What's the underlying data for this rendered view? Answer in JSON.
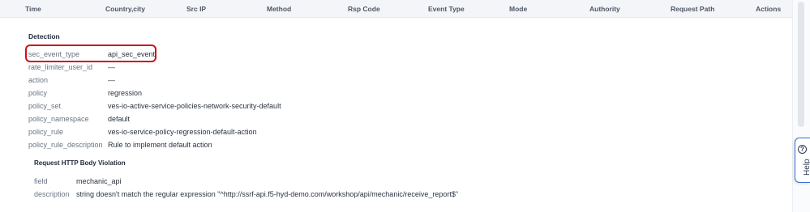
{
  "table_header": {
    "columns": [
      "Time",
      "Country,city",
      "Src IP",
      "Method",
      "Rsp Code",
      "Event Type",
      "Mode",
      "Authority",
      "Request Path",
      "Actions"
    ]
  },
  "detection": {
    "title": "Detection",
    "rows": [
      {
        "key": "sec_event_type",
        "value": "api_sec_event"
      },
      {
        "key": "rate_limiter_user_id",
        "value": "—"
      },
      {
        "key": "action",
        "value": "—"
      },
      {
        "key": "policy",
        "value": "regression"
      },
      {
        "key": "policy_set",
        "value": "ves-io-active-service-policies-network-security-default"
      },
      {
        "key": "policy_namespace",
        "value": "default"
      },
      {
        "key": "policy_rule",
        "value": "ves-io-service-policy-regression-default-action"
      },
      {
        "key": "policy_rule_description",
        "value": "Rule to implement default action"
      }
    ]
  },
  "violation": {
    "title": "Request HTTP Body Violation",
    "rows": [
      {
        "key": "field",
        "value": "mechanic_api"
      },
      {
        "key": "description",
        "value": "string doesn't match the regular expression \"^http://ssrf-api.f5-hyd-demo.com/workshop/api/mechanic/receive_report$\""
      }
    ]
  },
  "help": {
    "label": "Help",
    "icon": "question-icon"
  },
  "colors": {
    "highlight": "#d0121b",
    "help_border": "#3a6fd8"
  }
}
